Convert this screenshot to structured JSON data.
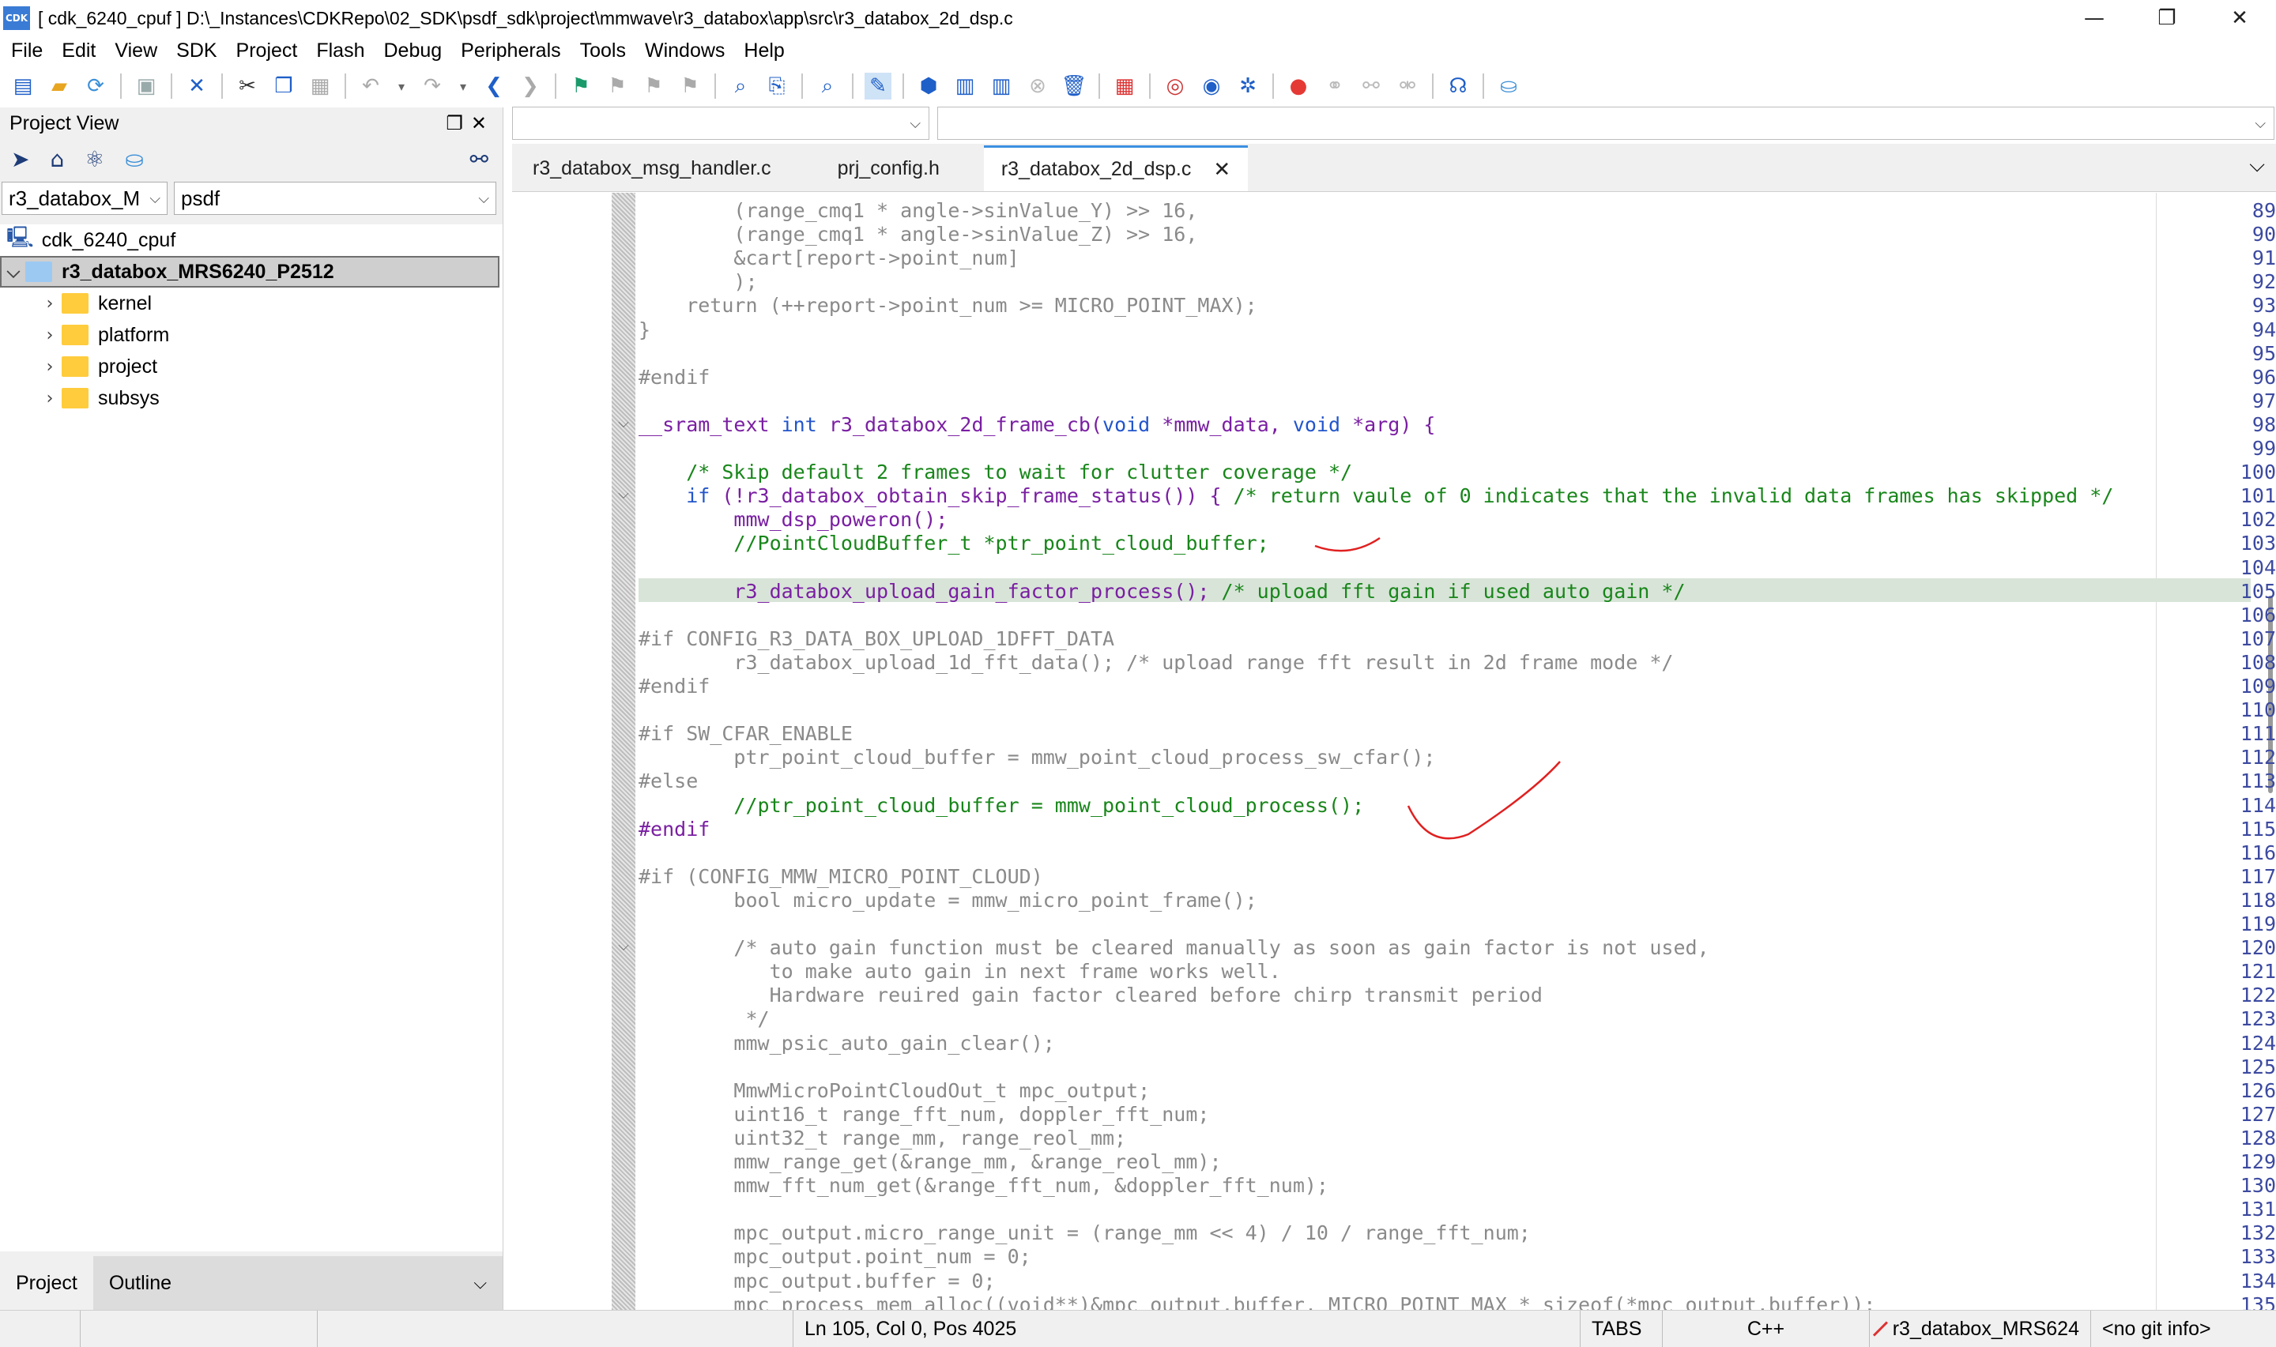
{
  "window": {
    "app_icon_text": "CDK",
    "title": "[ cdk_6240_cpuf ] D:\\_Instances\\CDKRepo\\02_SDK\\psdf_sdk\\project\\mmwave\\r3_databox\\app\\src\\r3_databox_2d_dsp.c",
    "minimize": "—",
    "restore": "❐",
    "close": "✕"
  },
  "menu": [
    "File",
    "Edit",
    "View",
    "SDK",
    "Project",
    "Flash",
    "Debug",
    "Peripherals",
    "Tools",
    "Windows",
    "Help"
  ],
  "toolbar_icons": [
    "new-file-icon",
    "open-folder-icon",
    "refresh-icon",
    "save-icon",
    "close-icon",
    "cut-icon",
    "copy-icon",
    "paste-icon",
    "undo-icon",
    "redo-icon",
    "back-icon",
    "forward-icon",
    "flag-icon",
    "flag-icon",
    "flag-icon",
    "flag-icon",
    "find-icon",
    "find-replace-icon",
    "find-in-files-icon",
    "build-icon",
    "package-icon",
    "rebuild-icon",
    "clean-icon",
    "stop-icon",
    "flash-icon",
    "debug-icon",
    "zoom-icon",
    "settings-icon",
    "breakpoint-icon",
    "link-icon",
    "link-icon",
    "unlink-icon",
    "help-icon",
    "download-icon"
  ],
  "project_view": {
    "title": "Project View",
    "config_select": "r3_databox_M",
    "workspace_select": "psdf",
    "tree": {
      "root": "cdk_6240_cpuf",
      "project": "r3_databox_MRS6240_P2512",
      "folders": [
        "kernel",
        "platform",
        "project",
        "subsys"
      ]
    },
    "bottom_tabs": [
      "Project",
      "Outline"
    ]
  },
  "editor_tabs": [
    {
      "label": "r3_databox_msg_handler.c",
      "active": false
    },
    {
      "label": "prj_config.h",
      "active": false
    },
    {
      "label": "r3_databox_2d_dsp.c",
      "active": true
    }
  ],
  "code": {
    "first_line": 89,
    "highlight_line": 105,
    "lines": [
      [
        {
          "t": "        (range_cmq1 * angle->sinValue_Y) >> 16,",
          "c": "#8a8a8a"
        }
      ],
      [
        {
          "t": "        (range_cmq1 * angle->sinValue_Z) >> 16,",
          "c": "#8a8a8a"
        }
      ],
      [
        {
          "t": "        &cart[report->point_num]",
          "c": "#8a8a8a"
        }
      ],
      [
        {
          "t": "        );",
          "c": "#8a8a8a"
        }
      ],
      [
        {
          "t": "    return (++report->point_num >= MICRO_POINT_MAX);",
          "c": "#8a8a8a"
        }
      ],
      [
        {
          "t": "}",
          "c": "#8a8a8a"
        }
      ],
      [],
      [
        {
          "t": "#endif",
          "c": "#8a8a8a"
        }
      ],
      [],
      [
        {
          "t": "__sram_text ",
          "c": "#7a1fa2"
        },
        {
          "t": "int",
          "c": "#2255cc"
        },
        {
          "t": " r3_databox_2d_frame_cb(",
          "c": "#7a1fa2"
        },
        {
          "t": "void",
          "c": "#2255cc"
        },
        {
          "t": " *mmw_data, ",
          "c": "#7a1fa2"
        },
        {
          "t": "void",
          "c": "#2255cc"
        },
        {
          "t": " *arg) {",
          "c": "#7a1fa2"
        }
      ],
      [],
      [
        {
          "t": "    /* Skip default 2 frames to wait for clutter coverage */",
          "c": "#18861a"
        }
      ],
      [
        {
          "t": "    ",
          "c": "#000"
        },
        {
          "t": "if",
          "c": "#2255cc"
        },
        {
          "t": " (!r3_databox_obtain_skip_frame_status()) { ",
          "c": "#7a1fa2"
        },
        {
          "t": "/* return vaule of 0 indicates that the invalid data frames has skipped */",
          "c": "#18861a"
        }
      ],
      [
        {
          "t": "        mmw_dsp_poweron();",
          "c": "#7a1fa2"
        }
      ],
      [
        {
          "t": "        //PointCloudBuffer_t *ptr_point_cloud_buffer;",
          "c": "#18861a"
        }
      ],
      [],
      [
        {
          "t": "        r3_databox_upload_gain_factor_process(); ",
          "c": "#7a1fa2"
        },
        {
          "t": "/* upload fft gain if used auto gain */",
          "c": "#18861a"
        }
      ],
      [],
      [
        {
          "t": "#if CONFIG_R3_DATA_BOX_UPLOAD_1DFFT_DATA",
          "c": "#8a8a8a"
        }
      ],
      [
        {
          "t": "        r3_databox_upload_1d_fft_data(); /* upload range fft result in 2d frame mode */",
          "c": "#8a8a8a"
        }
      ],
      [
        {
          "t": "#endif",
          "c": "#8a8a8a"
        }
      ],
      [],
      [
        {
          "t": "#if SW_CFAR_ENABLE",
          "c": "#8a8a8a"
        }
      ],
      [
        {
          "t": "        ptr_point_cloud_buffer = mmw_point_cloud_process_sw_cfar();",
          "c": "#8a8a8a"
        }
      ],
      [
        {
          "t": "#else",
          "c": "#8a8a8a"
        }
      ],
      [
        {
          "t": "        //ptr_point_cloud_buffer = mmw_point_cloud_process();",
          "c": "#18861a"
        }
      ],
      [
        {
          "t": "#endif",
          "c": "#7a1fa2"
        }
      ],
      [],
      [
        {
          "t": "#if (CONFIG_MMW_MICRO_POINT_CLOUD)",
          "c": "#8a8a8a"
        }
      ],
      [
        {
          "t": "        bool micro_update = mmw_micro_point_frame();",
          "c": "#8a8a8a"
        }
      ],
      [],
      [
        {
          "t": "        /* auto gain function must be cleared manually as soon as gain factor is not used,",
          "c": "#8a8a8a"
        }
      ],
      [
        {
          "t": "           to make auto gain in next frame works well.",
          "c": "#8a8a8a"
        }
      ],
      [
        {
          "t": "           Hardware reuired gain factor cleared before chirp transmit period",
          "c": "#8a8a8a"
        }
      ],
      [
        {
          "t": "         */",
          "c": "#8a8a8a"
        }
      ],
      [
        {
          "t": "        mmw_psic_auto_gain_clear();",
          "c": "#8a8a8a"
        }
      ],
      [],
      [
        {
          "t": "        MmwMicroPointCloudOut_t mpc_output;",
          "c": "#8a8a8a"
        }
      ],
      [
        {
          "t": "        uint16_t range_fft_num, doppler_fft_num;",
          "c": "#8a8a8a"
        }
      ],
      [
        {
          "t": "        uint32_t range_mm, range_reol_mm;",
          "c": "#8a8a8a"
        }
      ],
      [
        {
          "t": "        mmw_range_get(&range_mm, &range_reol_mm);",
          "c": "#8a8a8a"
        }
      ],
      [
        {
          "t": "        mmw_fft_num_get(&range_fft_num, &doppler_fft_num);",
          "c": "#8a8a8a"
        }
      ],
      [],
      [
        {
          "t": "        mpc_output.micro_range_unit = (range_mm << 4) / 10 / range_fft_num;",
          "c": "#8a8a8a"
        }
      ],
      [
        {
          "t": "        mpc_output.point_num = 0;",
          "c": "#8a8a8a"
        }
      ],
      [
        {
          "t": "        mpc_output.buffer = 0;",
          "c": "#8a8a8a"
        }
      ],
      [
        {
          "t": "        mpc_process_mem_alloc((void**)&mpc_output.buffer, MICRO_POINT_MAX * sizeof(*mpc_output.buffer));",
          "c": "#8a8a8a"
        }
      ]
    ],
    "fold_lines": [
      98,
      101,
      120
    ]
  },
  "status": {
    "position": "Ln 105, Col 0, Pos 4025",
    "indent": "TABS",
    "language": "C++",
    "git_project": "r3_databox_MRS624",
    "git_info": "<no git info>"
  },
  "colors": {
    "accent": "#3b8fe0",
    "annotation": "#e02020"
  }
}
